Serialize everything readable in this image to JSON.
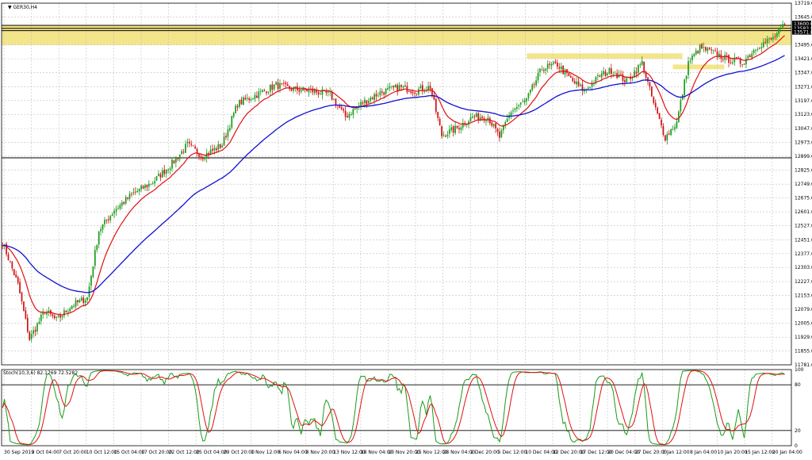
{
  "chart_data": {
    "type": "candlestick",
    "symbol_label": "GER30,H4",
    "colors": {
      "background": "#ffffff",
      "grid": "#c0c0c0",
      "bull": "#1a9a1a",
      "bear": "#d01010",
      "ma_fast": "#e01010",
      "ma_slow": "#1010d0",
      "zone": "#f3e58a",
      "stoch_main": "#1a9a1a",
      "stoch_signal": "#e01010"
    },
    "main_panel": {
      "y_ticks": [
        11781.0,
        11855.0,
        11929.0,
        12005.0,
        12079.0,
        12153.0,
        12227.0,
        12303.0,
        12377.0,
        12451.0,
        12527.0,
        12601.0,
        12675.0,
        12749.0,
        12825.0,
        12899.0,
        12973.0,
        13047.0,
        13123.0,
        13197.0,
        13271.0,
        13347.0,
        13421.0,
        13495.0,
        13645.0,
        13719.0
      ],
      "y_tick_labels": [
        "11781.0",
        "11855.0",
        "11929.0",
        "12005.0",
        "12079.0",
        "12153.0",
        "12227.0",
        "12303.0",
        "12377.0",
        "12451.0",
        "12527.0",
        "12601.0",
        "12675.0",
        "12749.0",
        "12825.0",
        "12899.0",
        "12973.0",
        "13047.0",
        "13123.0",
        "13197.0",
        "13271.0",
        "13347.0",
        "13421.0",
        "13495.0",
        "13645.0",
        "13719.0"
      ],
      "ylim": [
        11781.0,
        13719.0
      ],
      "price_tags": [
        "13600.0",
        "13583.8",
        "13571.8"
      ],
      "horizontal_lines": [
        13600.0,
        13583.8,
        13571.8,
        12890.0
      ],
      "zones": [
        {
          "from_x": 0.0,
          "to_x": 1.0,
          "low": 13495.0,
          "high": 13600.0
        },
        {
          "from_x": 0.665,
          "to_x": 0.862,
          "low": 13421.0,
          "high": 13450.0
        },
        {
          "from_x": 0.85,
          "to_x": 0.915,
          "low": 13365.0,
          "high": 13390.0
        }
      ]
    },
    "x_tick_labels": [
      "30 Sep 2019",
      "3 Oct 04:00",
      "7 Oct 20:00",
      "10 Oct 12:00",
      "15 Oct 04:00",
      "17 Oct 20:00",
      "22 Oct 12:00",
      "25 Oct 04:00",
      "29 Oct 20:00",
      "1 Nov 12:00",
      "6 Nov 04:00",
      "8 Nov 20:00",
      "13 Nov 12:00",
      "18 Nov 04:00",
      "20 Nov 20:00",
      "25 Nov 12:00",
      "28 Nov 04:00",
      "2 Dec 20:00",
      "5 Dec 12:00",
      "10 Dec 04:00",
      "12 Dec 20:00",
      "17 Dec 12:00",
      "20 Dec 04:00",
      "27 Dec 20:00",
      "3 Jan 12:00",
      "8 Jan 04:00",
      "10 Jan 20:00",
      "15 Jan 12:00",
      "20 Jan 04:00"
    ],
    "close_anchors": [
      [
        0,
        12440
      ],
      [
        8,
        12210
      ],
      [
        14,
        11920
      ],
      [
        22,
        12070
      ],
      [
        28,
        12020
      ],
      [
        36,
        12100
      ],
      [
        44,
        12140
      ],
      [
        50,
        12500
      ],
      [
        58,
        12610
      ],
      [
        68,
        12700
      ],
      [
        78,
        12760
      ],
      [
        88,
        12860
      ],
      [
        96,
        12960
      ],
      [
        104,
        12900
      ],
      [
        114,
        12960
      ],
      [
        122,
        13180
      ],
      [
        132,
        13230
      ],
      [
        142,
        13280
      ],
      [
        150,
        13260
      ],
      [
        160,
        13250
      ],
      [
        170,
        13230
      ],
      [
        178,
        13110
      ],
      [
        186,
        13180
      ],
      [
        196,
        13240
      ],
      [
        206,
        13270
      ],
      [
        214,
        13250
      ],
      [
        222,
        13270
      ],
      [
        228,
        13010
      ],
      [
        236,
        13050
      ],
      [
        244,
        13110
      ],
      [
        252,
        13110
      ],
      [
        258,
        13000
      ],
      [
        264,
        13140
      ],
      [
        272,
        13200
      ],
      [
        280,
        13370
      ],
      [
        288,
        13390
      ],
      [
        296,
        13300
      ],
      [
        302,
        13250
      ],
      [
        310,
        13330
      ],
      [
        316,
        13360
      ],
      [
        324,
        13300
      ],
      [
        332,
        13400
      ],
      [
        338,
        13180
      ],
      [
        344,
        13000
      ],
      [
        350,
        13080
      ],
      [
        356,
        13400
      ],
      [
        362,
        13480
      ],
      [
        370,
        13450
      ],
      [
        376,
        13420
      ],
      [
        384,
        13400
      ],
      [
        392,
        13490
      ],
      [
        400,
        13530
      ],
      [
        406,
        13600
      ]
    ],
    "stoch_panel": {
      "label": "Stoch(10,3,6) 82.1769 72.5282",
      "main_value": 82.1769,
      "signal_value": 72.5282,
      "ylim": [
        0,
        100
      ],
      "levels": [
        80,
        20
      ],
      "y_tick_labels": [
        "100",
        "80",
        "20",
        "0"
      ]
    }
  }
}
